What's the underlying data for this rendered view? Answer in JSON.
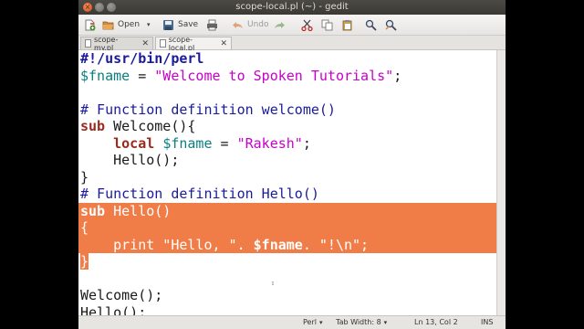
{
  "window": {
    "title": "scope-local.pl (~) - gedit"
  },
  "toolbar": {
    "open_label": "Open",
    "save_label": "Save",
    "undo_label": "Undo"
  },
  "tabs": [
    {
      "label": "scope-my.pl"
    },
    {
      "label": "scope-local.pl"
    }
  ],
  "code": {
    "l1": "#!/usr/bin/perl",
    "l2_var": "$fname",
    "l2_eq": " = ",
    "l2_str": "\"Welcome to Spoken Tutorials\"",
    "l2_end": ";",
    "l4": "# Function definition welcome()",
    "l5_kw": "sub",
    "l5_rest": " Welcome(){",
    "l6_indent": "    ",
    "l6_kw": "local",
    "l6_sp": " ",
    "l6_var": "$fname",
    "l6_eq": " = ",
    "l6_str": "\"Rakesh\"",
    "l6_end": ";",
    "l7": "    Hello();",
    "l8": "}",
    "l9": "# Function definition Hello()",
    "l10_kw": "sub",
    "l10_rest": " Hello()",
    "l11": "{",
    "l12_a": "    print \"Hello, \". ",
    "l12_var": "$fname",
    "l12_b": ". \"!\\n\";",
    "l13": "}",
    "l15": "Welcome();",
    "l16": "Hello();"
  },
  "statusbar": {
    "language": "Perl",
    "tab_width": "Tab Width: 8",
    "position": "Ln 13, Col 2",
    "mode": "INS"
  }
}
